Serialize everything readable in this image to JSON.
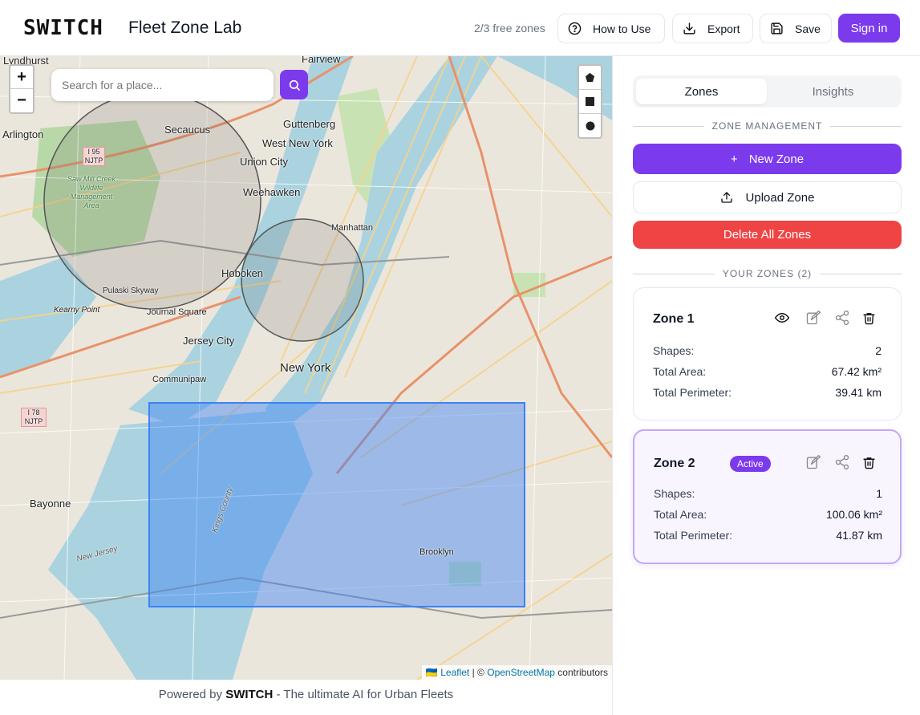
{
  "header": {
    "logo": "SWITCH",
    "title": "Fleet Zone Lab",
    "free_zones": "2/3 free zones",
    "how_to_use": "How to Use",
    "export": "Export",
    "save": "Save",
    "sign_in": "Sign in",
    "accent_color": "#7c3aed"
  },
  "map": {
    "search_placeholder": "Search for a place...",
    "zoom_in": "+",
    "zoom_out": "−",
    "attribution": {
      "flag": "🇺🇦",
      "leaflet": "Leaflet",
      "sep": "| ©",
      "osm": "OpenStreetMap",
      "contributors": "contributors"
    },
    "labels": {
      "lyndhurst": "Lyndhurst",
      "fairview": "Fairview",
      "arlington": "Arlington",
      "secaucus": "Secaucus",
      "guttenberg": "Guttenberg",
      "west_new_york": "West New York",
      "union_city": "Union City",
      "weehawken": "Weehawken",
      "manhattan": "Manhattan",
      "hoboken": "Hoboken",
      "pulaski_skyway": "Pulaski Skyway",
      "kearny_point": "Kearny Point",
      "journal_square": "Journal Square",
      "jersey_city": "Jersey City",
      "new_york": "New York",
      "communipaw": "Communipaw",
      "bayonne": "Bayonne",
      "brooklyn": "Brooklyn",
      "kings_county": "Kings County",
      "new_jersey": "New Jersey",
      "saw_mill": "Saw Mill Creek Wildlife Management Area",
      "i95": "I 95 NJTP",
      "i78": "I 78 NJTP"
    },
    "zone_fill_color": "#3b82f6",
    "circle_color": "#555555"
  },
  "footer": {
    "prefix": "Powered by",
    "brand": "SWITCH",
    "suffix": "- The ultimate AI for Urban Fleets"
  },
  "sidebar": {
    "tabs": [
      "Zones",
      "Insights"
    ],
    "zone_management": "ZONE MANAGEMENT",
    "new_zone": "New Zone",
    "new_zone_plus": "+",
    "upload_zone": "Upload Zone",
    "delete_all": "Delete All Zones",
    "your_zones": "YOUR ZONES (2)",
    "labels": {
      "shapes": "Shapes:",
      "area": "Total Area:",
      "perimeter": "Total Perimeter:"
    },
    "zones": [
      {
        "name": "Zone 1",
        "shapes": "2",
        "area": "67.42 km²",
        "perimeter": "39.41 km",
        "active": false
      },
      {
        "name": "Zone 2",
        "badge": "Active",
        "shapes": "1",
        "area": "100.06 km²",
        "perimeter": "41.87 km",
        "active": true
      }
    ],
    "delete_color": "#ef4444"
  }
}
